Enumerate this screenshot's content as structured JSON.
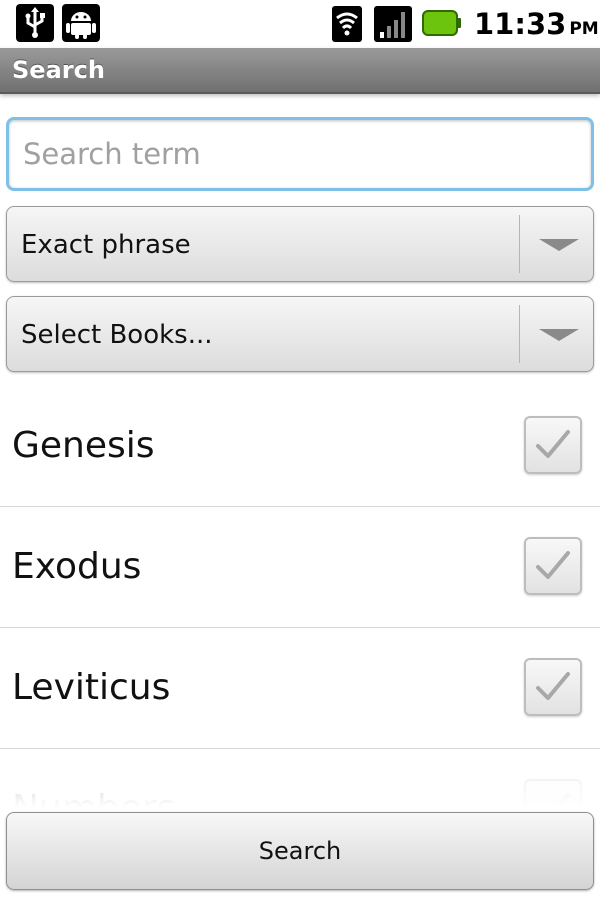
{
  "status_bar": {
    "time": "11:33",
    "ampm": "PM",
    "icons": [
      "usb-icon",
      "android-debug-icon",
      "wifi-icon",
      "signal-icon",
      "battery-icon"
    ],
    "battery_color": "#6cc40e"
  },
  "title_bar": {
    "title": "Search"
  },
  "search": {
    "placeholder": "Search term",
    "value": ""
  },
  "match_mode": {
    "selected": "Exact phrase"
  },
  "book_selector": {
    "selected": "Select Books..."
  },
  "books": [
    {
      "name": "Genesis",
      "checked": true
    },
    {
      "name": "Exodus",
      "checked": true
    },
    {
      "name": "Leviticus",
      "checked": true
    },
    {
      "name": "Numbers",
      "checked": true
    }
  ],
  "actions": {
    "search_label": "Search"
  },
  "colors": {
    "input_focus": "#7fc0e8",
    "titlebar": "#808080"
  }
}
